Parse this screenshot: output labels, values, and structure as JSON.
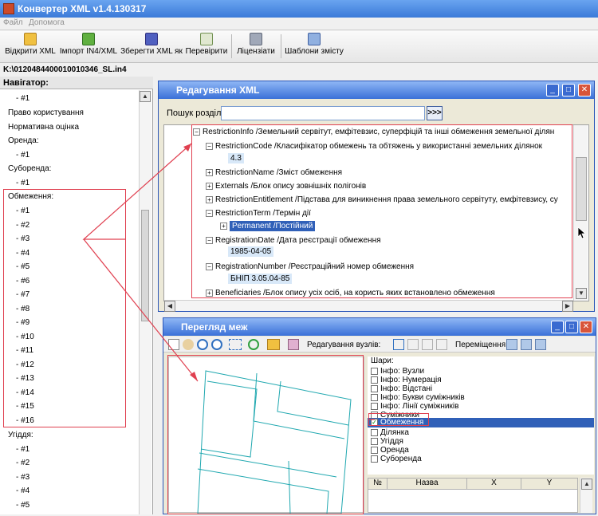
{
  "app": {
    "title": "Конвертер XML v1.4.130317"
  },
  "menu": {
    "file": "Файл",
    "help": "Допомога"
  },
  "toolbar": {
    "open": "Відкрити XML",
    "import": "Імпорт IN4/XML",
    "save_as": "Зберегти XML як",
    "check": "Перевірити",
    "licenses": "Ліцензіати",
    "templates": "Шаблони змісту"
  },
  "path": "K:\\0120484400010010346_SL.in4",
  "navigator": {
    "header": "Навігатор:",
    "items": [
      "- #1",
      "Право користування",
      "Нормативна оцінка",
      "Оренда:",
      "- #1",
      "Суборенда:",
      "- #1",
      "Обмеження:",
      "- #1",
      "- #2",
      "- #3",
      "- #4",
      "- #5",
      "- #6",
      "- #7",
      "- #8",
      "- #9",
      "- #10",
      "- #11",
      "- #12",
      "- #13",
      "- #14",
      "- #15",
      "- #16",
      "Угіддя:",
      "- #1",
      "- #2",
      "- #3",
      "- #4",
      "- #5"
    ]
  },
  "xml_editor": {
    "title": "Редагування XML",
    "search_label": "Пошук розділу:",
    "search_value": "",
    "search_go": ">>>",
    "tree": [
      "RestrictionInfo /Земельний сервітут, емфітевзис, суперфіцій та інші обмеження земельної ділян",
      "RestrictionCode /Класифікатор обмежень та обтяжень у використанні земельних ділянок",
      "4.3",
      "RestrictionName /Зміст обмеження",
      "Externals /Блок опису зовнішніх полігонів",
      "RestrictionEntitlement /Підстава для виникнення права земельного сервітуту, емфітевзису, су",
      "RestrictionTerm /Термін дії",
      "Permanent /Постійний",
      "RegistrationDate /Дата реєстрації обмеження",
      "1985-04-05",
      "RegistrationNumber /Реєстраційний номер обмеження",
      "БНІП 3.05.04-85",
      "Beneficiaries /Блок опису усіх осіб, на користь яких встановлено обмеження"
    ]
  },
  "map_view": {
    "title": "Перегляд меж",
    "node_edit_label": "Редагування вузлів:",
    "move_label": "Переміщення:",
    "layers_label": "Шари:",
    "layers": [
      {
        "name": "Інфо: Вузли",
        "checked": false
      },
      {
        "name": "Інфо: Нумерація",
        "checked": false
      },
      {
        "name": "Інфо: Відстані",
        "checked": false
      },
      {
        "name": "Інфо: Букви суміжників",
        "checked": false
      },
      {
        "name": "Інфо: Лінії суміжників",
        "checked": false
      },
      {
        "name": "Суміжники",
        "checked": false
      },
      {
        "name": "Обмеження",
        "checked": true
      },
      {
        "name": "Ділянка",
        "checked": false
      },
      {
        "name": "Угіддя",
        "checked": false
      },
      {
        "name": "Оренда",
        "checked": false
      },
      {
        "name": "Суборенда",
        "checked": false
      }
    ],
    "table_headers": [
      "№",
      "Назва",
      "X",
      "Y"
    ]
  },
  "colors": {
    "accent": "#3a70d8",
    "highlight": "#e04050",
    "polygon": "#20a8b0"
  }
}
